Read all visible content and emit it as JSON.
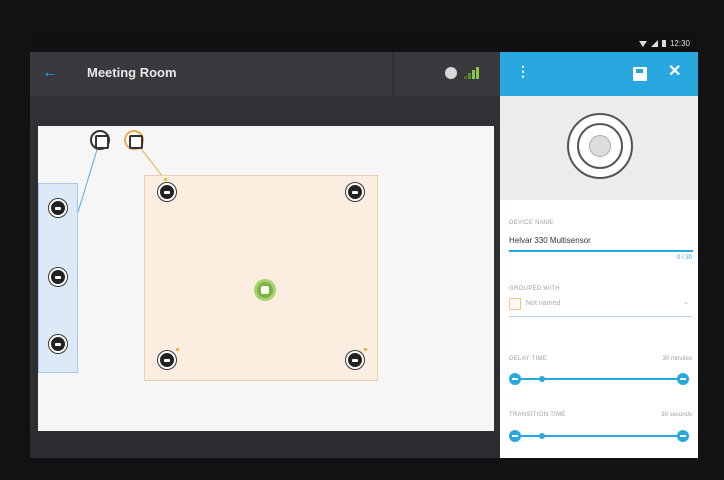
{
  "status": {
    "time": "12:30"
  },
  "toolbar": {
    "title": "Meeting Room",
    "back": "←"
  },
  "panel": {
    "more": "⋮",
    "close": "✕",
    "device_name_label": "DEVICE NAME",
    "device_name_value": "Helvar 330 Multisensor",
    "device_name_counter": "0 / 30",
    "grouped_with_label": "GROUPED WITH",
    "grouped_with_placeholder": "Not named",
    "grouped_with_caret": "⌄",
    "delay_time_label": "DELAY TIME",
    "delay_time_value": "30 minutes",
    "delay_time_level": 0.1,
    "transition_time_label": "TRANSITION TIME",
    "transition_time_value": "30 seconds",
    "transition_time_level": 0.1
  },
  "colors": {
    "accent": "#29a8e0",
    "sensor": "#7cb342",
    "zone": "#fbede0"
  },
  "icons": [
    "back-arrow-icon",
    "globe-icon",
    "signal-bars-icon",
    "more-vert-icon",
    "save-icon",
    "close-icon",
    "multisensor-icon"
  ]
}
